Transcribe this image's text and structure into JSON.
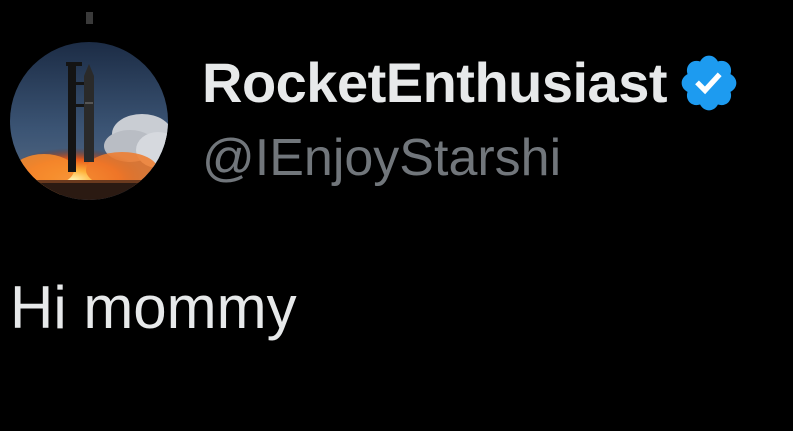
{
  "tweet": {
    "author": {
      "display_name": "RocketEnthusiast",
      "handle": "@IEnjoyStarshi",
      "verified": true,
      "verified_badge_color": "#1d9bf0",
      "avatar_icon": "rocket-launch-photo"
    },
    "text": "Hi mommy"
  },
  "theme": {
    "background": "#000000",
    "primary_text": "#e7e9ea",
    "secondary_text": "#71767b"
  }
}
